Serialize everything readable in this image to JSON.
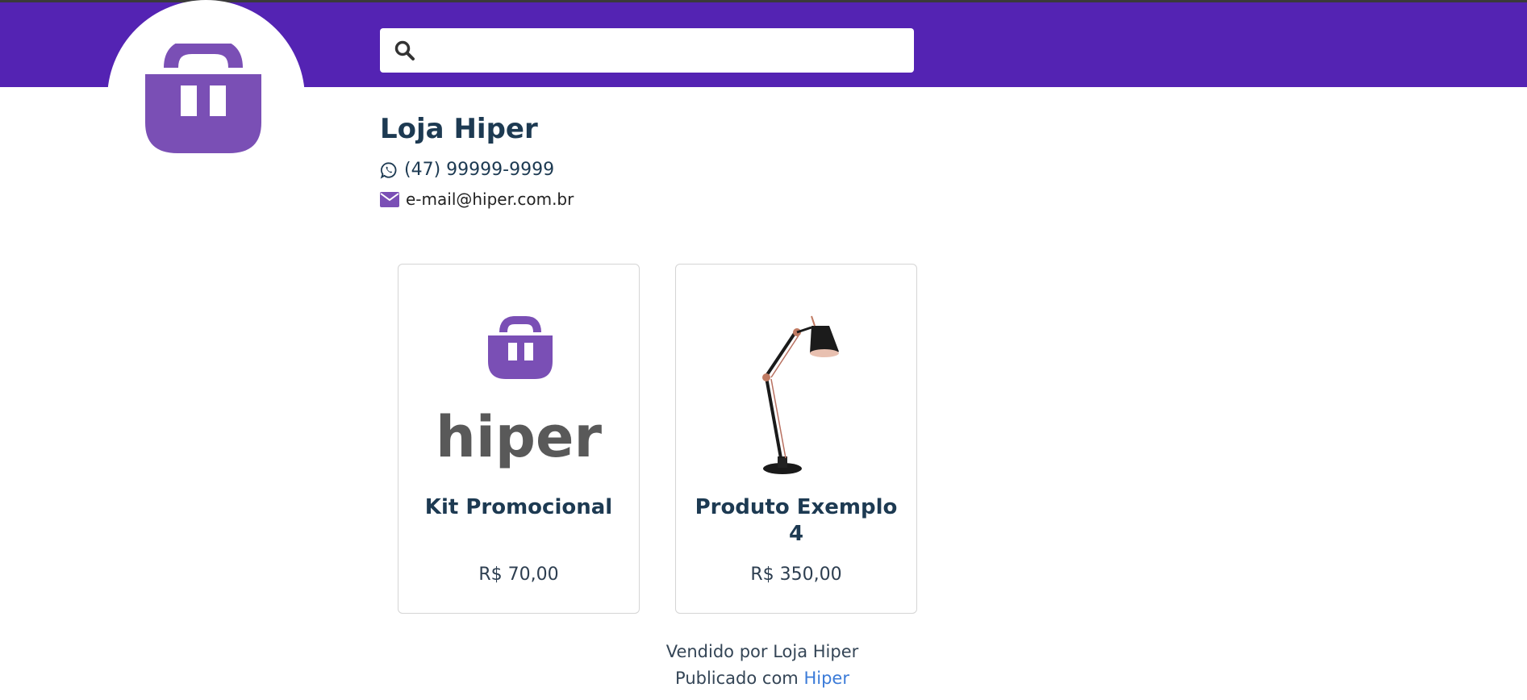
{
  "colors": {
    "brand": "#5423b3",
    "logo": "#7a4fb5",
    "link": "#3b7bd8"
  },
  "search": {
    "placeholder": "",
    "value": "",
    "icon": "search-icon"
  },
  "store": {
    "name": "Loja Hiper",
    "phone": "(47) 99999-9999",
    "phone_icon": "whatsapp-icon",
    "email": "e-mail@hiper.com.br",
    "email_icon": "envelope-icon"
  },
  "products": [
    {
      "name": "Kit Promocional",
      "price": "R$ 70,00",
      "image": "hiper-logo"
    },
    {
      "name": "Produto Exemplo 4",
      "price": "R$ 350,00",
      "image": "desk-lamp"
    }
  ],
  "product_logo_word": "hiper",
  "footer": {
    "sold_by": "Vendido por Loja Hiper",
    "published_prefix": "Publicado com",
    "published_link": "Hiper"
  }
}
